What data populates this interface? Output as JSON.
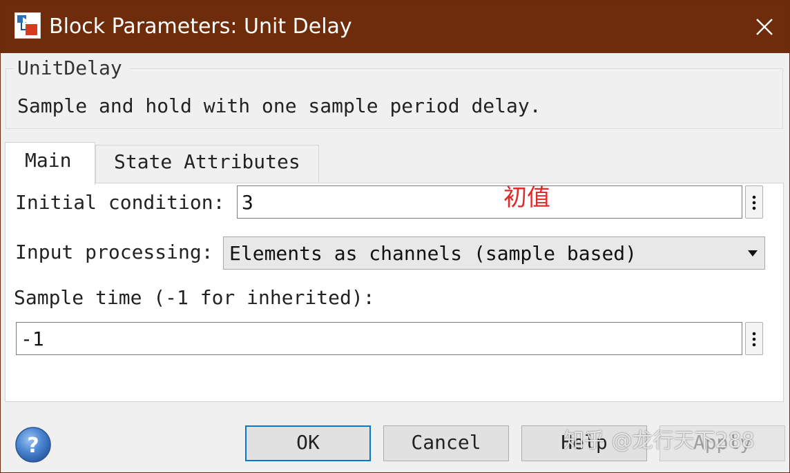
{
  "window": {
    "title": "Block Parameters: Unit Delay",
    "app_icon": "simulink-block-icon",
    "close_icon": "close-icon",
    "title_bar_color": "#6e2c0b"
  },
  "block": {
    "group_title": "UnitDelay",
    "description": "Sample and hold with one sample period delay."
  },
  "tabs": [
    {
      "label": "Main",
      "selected": true
    },
    {
      "label": "State Attributes",
      "selected": false
    }
  ],
  "main": {
    "initial_condition": {
      "label": "Initial condition:",
      "value": "3",
      "annotation": "初值",
      "annotation_color": "#e02a2a"
    },
    "input_processing": {
      "label": "Input processing:",
      "selected": "Elements as channels (sample based)"
    },
    "sample_time": {
      "label": "Sample time (-1 for inherited):",
      "value": "-1"
    }
  },
  "buttons": {
    "ok": "OK",
    "cancel": "Cancel",
    "help": "Help",
    "apply": "Apply"
  },
  "help_icon": "help-icon",
  "accent_color": "#0078d7",
  "watermark": "知乎 @龙行天下288"
}
